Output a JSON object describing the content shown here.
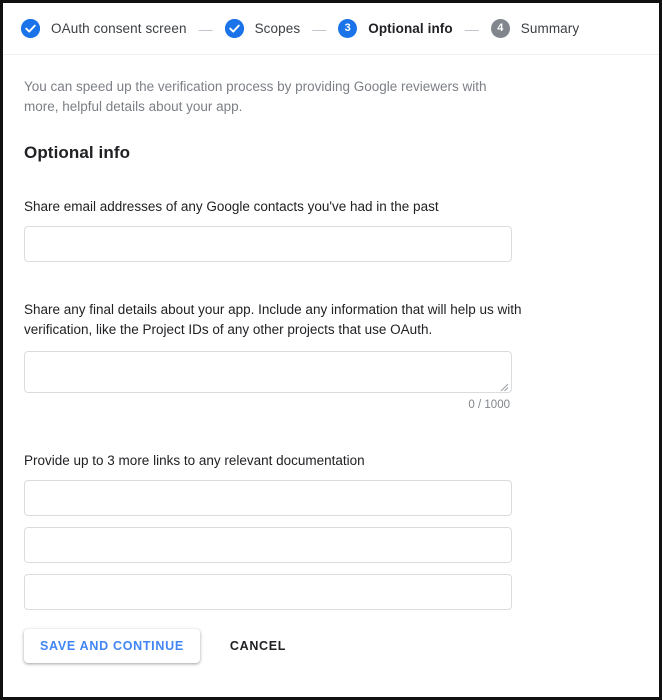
{
  "stepper": {
    "steps": [
      {
        "badge_icon": "check-icon",
        "badge_number": "",
        "label": "OAuth consent screen",
        "state": "done"
      },
      {
        "badge_icon": "check-icon",
        "badge_number": "",
        "label": "Scopes",
        "state": "done"
      },
      {
        "badge_icon": "",
        "badge_number": "3",
        "label": "Optional info",
        "state": "active"
      },
      {
        "badge_icon": "",
        "badge_number": "4",
        "label": "Summary",
        "state": "pending"
      }
    ],
    "separator": "—"
  },
  "main": {
    "intro": "You can speed up the verification process by providing Google reviewers with more, helpful details about your app.",
    "section_title": "Optional info",
    "contacts": {
      "label": "Share email addresses of any Google contacts you've had in the past",
      "value": "",
      "placeholder": ""
    },
    "final_details": {
      "label": "Share any final details about your app. Include any information that will help us with verification, like the Project IDs of any other projects that use OAuth.",
      "value": "",
      "placeholder": "",
      "counter": "0 / 1000"
    },
    "links": {
      "label": "Provide up to 3 more links to any relevant documentation",
      "values": [
        "",
        "",
        ""
      ],
      "placeholder": ""
    }
  },
  "actions": {
    "save_label": "SAVE AND CONTINUE",
    "cancel_label": "CANCEL"
  },
  "colors": {
    "accent_blue": "#1a73e8",
    "button_blue": "#4285f4",
    "pending_gray": "#80868b",
    "border_gray": "#dadce0",
    "muted_text": "#7c8086"
  }
}
